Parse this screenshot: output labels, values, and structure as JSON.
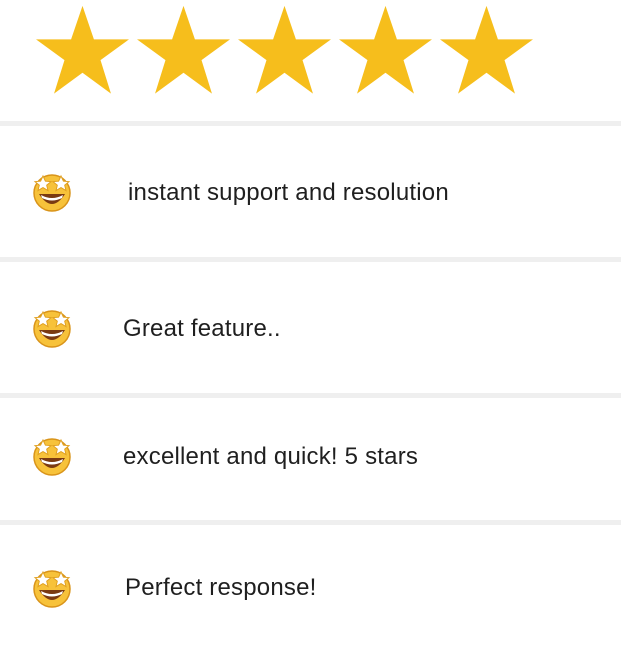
{
  "rating": {
    "value": 5,
    "max": 5,
    "star_color": "#F6BE1C"
  },
  "feedback": [
    {
      "emoji": "star-struck-emoji",
      "text": "instant support and resolution"
    },
    {
      "emoji": "star-struck-emoji",
      "text": "Great feature.."
    },
    {
      "emoji": "star-struck-emoji",
      "text": "excellent and quick! 5 stars"
    },
    {
      "emoji": "star-struck-emoji",
      "text": "Perfect response!"
    }
  ]
}
